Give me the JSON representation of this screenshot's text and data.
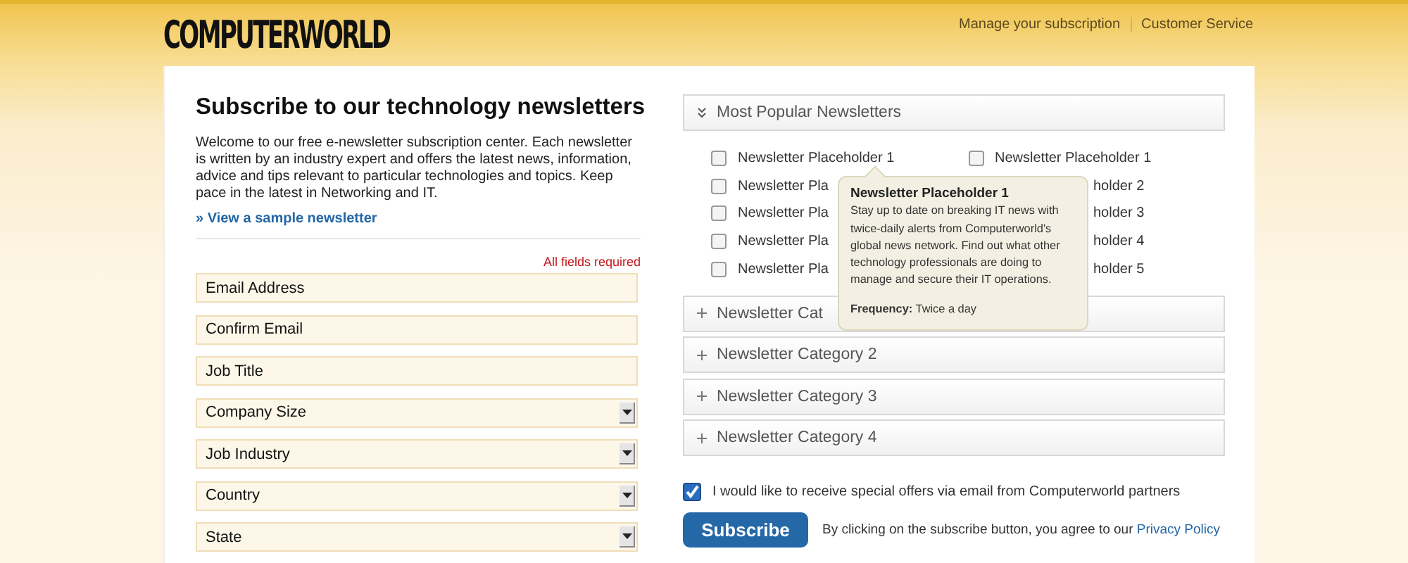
{
  "header": {
    "logo": "COMPUTERWORLD",
    "links": [
      "Manage your subscription",
      "Customer Service"
    ]
  },
  "intro": {
    "title": "Subscribe to our technology newsletters",
    "text": "Welcome to our free e-newsletter subscription center. Each newsletter is written by an industry expert and offers the latest news, information, advice and tips relevant to particular technologies and topics. Keep pace in the latest in Networking and IT.",
    "sample_link": "» View a sample newsletter"
  },
  "form": {
    "required_note": "All fields required",
    "fields": [
      {
        "kind": "text",
        "placeholder": "Email Address"
      },
      {
        "kind": "text",
        "placeholder": "Confirm Email"
      },
      {
        "kind": "text",
        "placeholder": "Job Title"
      },
      {
        "kind": "select",
        "placeholder": "Company Size"
      },
      {
        "kind": "select",
        "placeholder": "Job Industry"
      },
      {
        "kind": "select",
        "placeholder": "Country"
      },
      {
        "kind": "select",
        "placeholder": "State"
      }
    ]
  },
  "sections": [
    {
      "title": "Most Popular Newsletters",
      "expanded": true,
      "columns": [
        [
          {
            "label": "Newsletter Placeholder 1",
            "checked": false,
            "kind": "full"
          },
          {
            "label": "Newsletter Pla",
            "checked": false,
            "kind": "head"
          },
          {
            "label": "Newsletter Pla",
            "checked": false,
            "kind": "head"
          },
          {
            "label": "Newsletter Pla",
            "checked": false,
            "kind": "head"
          },
          {
            "label": "Newsletter Pla",
            "checked": false,
            "kind": "head"
          }
        ],
        [
          {
            "label": "Newsletter Placeholder 1",
            "checked": false,
            "kind": "full"
          },
          {
            "label": "holder 2",
            "kind": "tail"
          },
          {
            "label": "holder 3",
            "kind": "tail"
          },
          {
            "label": "holder 4",
            "kind": "tail"
          },
          {
            "label": "holder 5",
            "kind": "tail"
          }
        ]
      ]
    },
    {
      "title": "Newsletter Cat",
      "expanded": false
    },
    {
      "title": "Newsletter Category 2",
      "expanded": false
    },
    {
      "title": "Newsletter Category 3",
      "expanded": false
    },
    {
      "title": "Newsletter Category 4",
      "expanded": false
    }
  ],
  "tooltip": {
    "title": "Newsletter Placeholder 1",
    "text": "Stay up to date on breaking IT news with twice-daily alerts from Computerworld's global news network. Find out what other technology professionals are doing to manage and secure their IT operations.",
    "frequency": "**Frequency:** Twice a day"
  },
  "offers": {
    "label": "I would like to receive special offers via email from Computerworld partners",
    "checked": true
  },
  "submit": {
    "button": "Subscribe",
    "note": "By clicking on the subscribe button, you agree to our",
    "link": "Privacy Policy"
  }
}
